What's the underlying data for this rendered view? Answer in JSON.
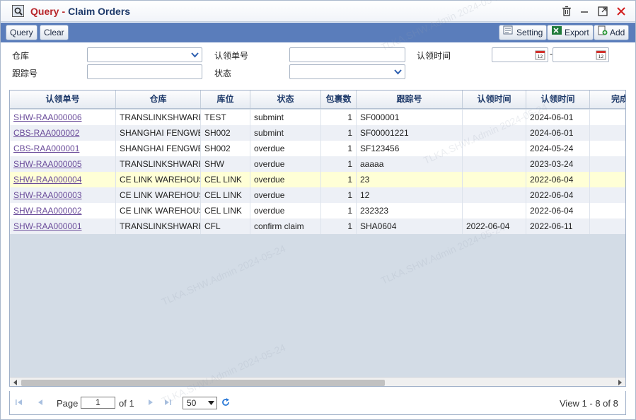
{
  "window": {
    "title_query": "Query",
    "title_sep": "-",
    "title_name": "Claim Orders"
  },
  "toolbar": {
    "query_label": "Query",
    "clear_label": "Clear",
    "setting_label": "Setting",
    "export_label": "Export",
    "add_label": "Add"
  },
  "form": {
    "warehouse_label": "仓库",
    "claim_no_label": "认领单号",
    "claim_time_label": "认领时间",
    "tracking_label": "跟踪号",
    "status_label": "状态",
    "time_sep": "-"
  },
  "grid": {
    "columns": [
      "认领单号",
      "仓库",
      "库位",
      "状态",
      "包裹数",
      "跟踪号",
      "认领时间",
      "认领时间",
      "完成"
    ],
    "rows": [
      {
        "claim_no": "SHW-RAA000006",
        "warehouse": "TRANSLINKSHWARE",
        "location": "TEST",
        "status": "submint",
        "packages": "1",
        "tracking": "SF000001",
        "time1": "",
        "time2": "2024-06-01"
      },
      {
        "claim_no": "CBS-RAA000002",
        "warehouse": "SHANGHAI FENGWEI",
        "location": "SH002",
        "status": "submint",
        "packages": "1",
        "tracking": "SF00001221",
        "time1": "",
        "time2": "2024-06-01"
      },
      {
        "claim_no": "CBS-RAA000001",
        "warehouse": "SHANGHAI FENGWEI",
        "location": "SH002",
        "status": "overdue",
        "packages": "1",
        "tracking": "SF123456",
        "time1": "",
        "time2": "2024-05-24"
      },
      {
        "claim_no": "SHW-RAA000005",
        "warehouse": "TRANSLINKSHWARE",
        "location": "SHW",
        "status": "overdue",
        "packages": "1",
        "tracking": "aaaaa",
        "time1": "",
        "time2": "2023-03-24"
      },
      {
        "claim_no": "SHW-RAA000004",
        "warehouse": "CE LINK WAREHOUSE",
        "location": "CEL LINK",
        "status": "overdue",
        "packages": "1",
        "tracking": "23",
        "time1": "",
        "time2": "2022-06-04"
      },
      {
        "claim_no": "SHW-RAA000003",
        "warehouse": "CE LINK WAREHOUSE",
        "location": "CEL LINK",
        "status": "overdue",
        "packages": "1",
        "tracking": "12",
        "time1": "",
        "time2": "2022-06-04"
      },
      {
        "claim_no": "SHW-RAA000002",
        "warehouse": "CE LINK WAREHOUSE",
        "location": "CEL LINK",
        "status": "overdue",
        "packages": "1",
        "tracking": "232323",
        "time1": "",
        "time2": "2022-06-04"
      },
      {
        "claim_no": "SHW-RAA000001",
        "warehouse": "TRANSLINKSHWARE",
        "location": "CFL",
        "status": "confirm claim",
        "packages": "1",
        "tracking": "SHA0604",
        "time1": "2022-06-04",
        "time2": "2022-06-11"
      }
    ]
  },
  "pager": {
    "page_label": "Page",
    "page_value": "1",
    "of_label": "of 1",
    "page_size": "50",
    "view_text": "View 1 - 8 of 8"
  },
  "watermark_text": "TLKA.SHW.Admin 2024-05-24",
  "colors": {
    "toolbar_bg": "#5a7dbb",
    "title_query": "#b8262b",
    "title_name": "#1e3a6a",
    "link": "#6a4b9a",
    "highlight_row": "#ffffd6"
  }
}
